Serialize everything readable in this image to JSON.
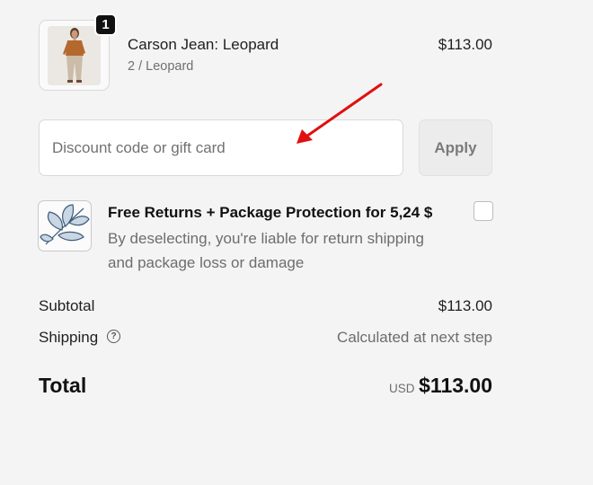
{
  "product": {
    "quantity_badge": "1",
    "name": "Carson Jean: Leopard",
    "variant": "2 / Leopard",
    "price": "$113.00",
    "image_icon": "product-photo-woman-icon"
  },
  "discount": {
    "placeholder": "Discount code or gift card",
    "value": "",
    "apply_label": "Apply"
  },
  "protection": {
    "icon": "leaf-shield-icon",
    "title": "Free Returns + Package Protection for 5,24 $",
    "description": "By deselecting, you're liable for return shipping and package loss or damage",
    "checked": false
  },
  "summary": {
    "subtotal_label": "Subtotal",
    "subtotal_value": "$113.00",
    "shipping_label": "Shipping",
    "shipping_help_icon": "question-circle-icon",
    "shipping_value": "Calculated at next step",
    "total_label": "Total",
    "currency": "USD",
    "total_value": "$113.00"
  },
  "annotation": {
    "arrow_color": "#e01010"
  }
}
